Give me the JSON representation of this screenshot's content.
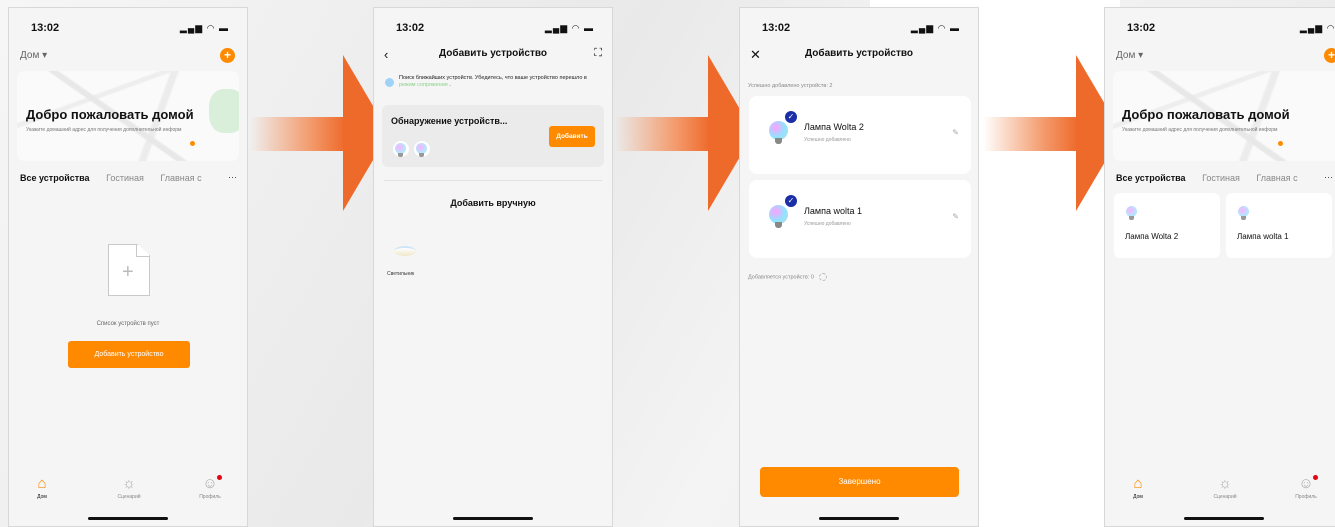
{
  "status": {
    "time": "13:02",
    "icons": "▂▄▆ ◠ ▬"
  },
  "screen1": {
    "home_title": "Дом ▾",
    "add_icon": "+",
    "welcome_title": "Добро пожаловать домой",
    "welcome_sub": "Укажите домашний адрес для получения дополнительной информ",
    "tabs": [
      "Все устройства",
      "Гостиная",
      "Главная с"
    ],
    "more": "···",
    "empty_text": "Список устройств пуст",
    "add_device_btn": "Добавить устройство"
  },
  "screen2": {
    "title": "Добавить устройство",
    "back": "‹",
    "scan": "⛶",
    "hint_text": "Поиск ближайших устройств. Убедитесь, что ваше устройство перешло в",
    "hint_link": "режим сопряжения",
    "hint_end": ".",
    "discover_title": "Обнаружение устройств...",
    "add_btn": "Добавить",
    "manual_title": "Добавить вручную",
    "lamp_label": "Светильник"
  },
  "screen3": {
    "title": "Добавить устройство",
    "close": "✕",
    "success_count": "Успешно добавлено устройств: 2",
    "devices": [
      {
        "name": "Лампа Wolta 2",
        "status": "Успешно добавлено"
      },
      {
        "name": "Лампа wolta 1",
        "status": "Успешно добавлено"
      }
    ],
    "adding_count": "Добавляется устройств: 0",
    "done_btn": "Завершено"
  },
  "screen4": {
    "home_title": "Дом ▾",
    "add_icon": "+",
    "welcome_title": "Добро пожаловать домой",
    "welcome_sub": "Укажите домашний адрес для получения дополнительной информ",
    "tabs": [
      "Все устройства",
      "Гостиная",
      "Главная с"
    ],
    "more": "···",
    "tiles": [
      "Лампа Wolta 2",
      "Лампа wolta 1"
    ]
  },
  "nav": {
    "home": "Дом",
    "scenes": "Сценарий",
    "profile": "Профиль",
    "home_icon": "⌂",
    "scenes_icon": "☼",
    "profile_icon": "☺"
  },
  "colors": {
    "accent": "#ff8a00",
    "arrow": "#ee6a2a",
    "check": "#1a2ea8"
  }
}
